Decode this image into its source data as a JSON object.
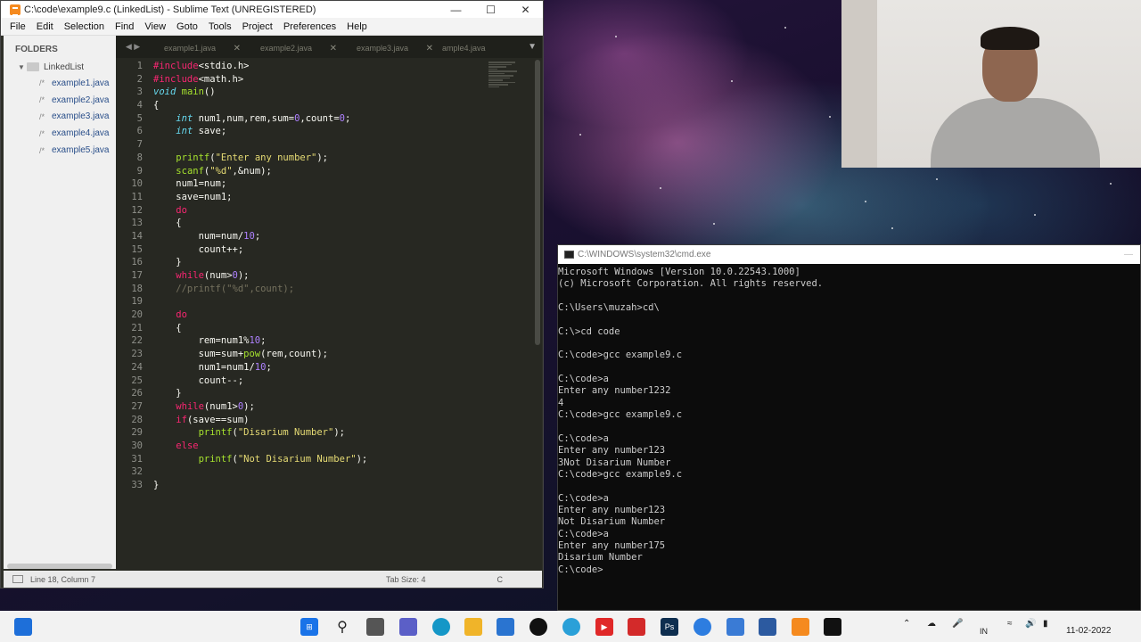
{
  "sublime": {
    "title": "C:\\code\\example9.c (LinkedList) - Sublime Text (UNREGISTERED)",
    "menu": [
      "File",
      "Edit",
      "Selection",
      "Find",
      "View",
      "Goto",
      "Tools",
      "Project",
      "Preferences",
      "Help"
    ],
    "sidebar": {
      "header": "FOLDERS",
      "folder": "LinkedList",
      "files": [
        "example1.java",
        "example2.java",
        "example3.java",
        "example4.java",
        "example5.java"
      ]
    },
    "tabs": [
      "example1.java",
      "example2.java",
      "example3.java",
      "ample4.java"
    ],
    "status": {
      "position": "Line 18, Column 7",
      "tab_size": "Tab Size: 4",
      "syntax": "C"
    }
  },
  "code_lines": [
    "#include<stdio.h>",
    "#include<math.h>",
    "void main()",
    "{",
    "    int num1,num,rem,sum=0,count=0;",
    "    int save;",
    "",
    "    printf(\"Enter any number\");",
    "    scanf(\"%d\",&num);",
    "    num1=num;",
    "    save=num1;",
    "    do",
    "    {",
    "        num=num/10;",
    "        count++;",
    "    }",
    "    while(num>0);",
    "    //printf(\"%d\",count);",
    "",
    "    do",
    "    {",
    "        rem=num1%10;",
    "        sum=sum+pow(rem,count);",
    "        num1=num1/10;",
    "        count--;",
    "    }",
    "    while(num1>0);",
    "    if(save==sum)",
    "        printf(\"Disarium Number\");",
    "    else",
    "        printf(\"Not Disarium Number\");",
    "",
    "}"
  ],
  "cmd": {
    "title": "C:\\WINDOWS\\system32\\cmd.exe",
    "lines": [
      "Microsoft Windows [Version 10.0.22543.1000]",
      "(c) Microsoft Corporation. All rights reserved.",
      "",
      "C:\\Users\\muzah>cd\\",
      "",
      "C:\\>cd code",
      "",
      "C:\\code>gcc example9.c",
      "",
      "C:\\code>a",
      "Enter any number1232",
      "4",
      "C:\\code>gcc example9.c",
      "",
      "C:\\code>a",
      "Enter any number123",
      "3Not Disarium Number",
      "C:\\code>gcc example9.c",
      "",
      "C:\\code>a",
      "Enter any number123",
      "Not Disarium Number",
      "C:\\code>a",
      "Enter any number175",
      "Disarium Number",
      "C:\\code>"
    ]
  },
  "taskbar": {
    "language": "IN",
    "date": "11-02-2022"
  },
  "colors": {
    "editor_bg": "#272822",
    "keyword": "#f92672",
    "type": "#66d9ef",
    "function": "#a6e22e",
    "string": "#e6db74",
    "number": "#ae81ff",
    "comment": "#75715e"
  }
}
